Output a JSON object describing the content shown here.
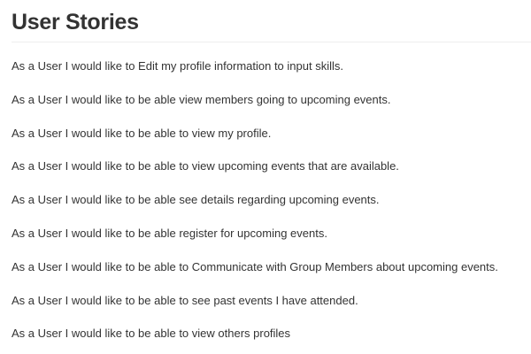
{
  "title": "User Stories",
  "stories": [
    "As a User I would like to Edit my profile information to input skills.",
    "As a User I would like to be able view members going to upcoming events.",
    "As a User I would like to be able to view my profile.",
    "As a User I would like to be able to view upcoming events that are available.",
    "As a User I would like to be able see details regarding upcoming events.",
    "As a User I would like to be able register for upcoming events.",
    "As a User I would like to be able to Communicate with Group Members about upcoming events.",
    "As a User I would like to be able to see past events I have attended.",
    "As a User I would like to be able to view others profiles"
  ]
}
